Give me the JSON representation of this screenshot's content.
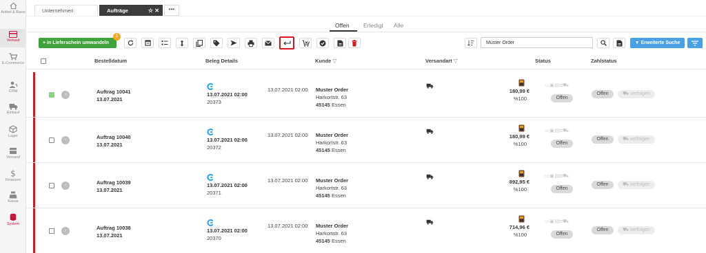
{
  "sidebar": {
    "items": [
      {
        "label": "Artikel & Basis",
        "icon": "home-icon"
      },
      {
        "label": "Verkauf",
        "icon": "credit-card-icon"
      },
      {
        "label": "E-Commerce",
        "icon": "cart-icon"
      },
      {
        "label": "CRM",
        "icon": "user-phone-icon"
      },
      {
        "label": "Einkauf",
        "icon": "truck-icon"
      },
      {
        "label": "Lager",
        "icon": "box-icon"
      },
      {
        "label": "Versand",
        "icon": "package-icon"
      },
      {
        "label": "Finanzen",
        "icon": "dollar-icon"
      },
      {
        "label": "Kasse",
        "icon": "register-icon"
      },
      {
        "label": "System",
        "icon": "database-icon"
      }
    ]
  },
  "doc_tabs": {
    "tab1": "Unternehmen",
    "tab2": "Aufträge",
    "more": "•••"
  },
  "status_tabs": {
    "open": "Offen",
    "done": "Erledigt",
    "all": "Alle"
  },
  "toolbar": {
    "convert_label": "in Lieferschein umwandeln",
    "badge": "1",
    "search_value": "Muster Order",
    "extended_search": "Erweiterte Suche"
  },
  "table": {
    "headers": {
      "order_date": "Bestelldatum",
      "doc_details": "Beleg Details",
      "customer": "Kunde",
      "shipping": "Versandart",
      "status": "Status",
      "payment": "Zahlstatus"
    },
    "rows": [
      {
        "order": "Auftrag 10041",
        "date": "13.07.2021",
        "doc_date": "13.07.2021 02:00",
        "doc_no": "20373",
        "created": "13.07.2021 02:00",
        "name": "Muster Order",
        "street": "Harkortstr. 63",
        "zip": "45145",
        "city": "Essen",
        "amount": "180,99 €",
        "percent": "%100",
        "status": "Offen",
        "pay": "Offen",
        "track": "verfolgen",
        "checked": true
      },
      {
        "order": "Auftrag 10040",
        "date": "13.07.2021",
        "doc_date": "13.07.2021 02:00",
        "doc_no": "20372",
        "created": "13.07.2021 02:00",
        "name": "Muster Order",
        "street": "Harkortstr. 63",
        "zip": "45145",
        "city": "Essen",
        "amount": "180,99 €",
        "percent": "%100",
        "status": "Offen",
        "pay": "Offen",
        "track": "verfolgen",
        "checked": false
      },
      {
        "order": "Auftrag 10039",
        "date": "13.07.2021",
        "doc_date": "13.07.2021 02:00",
        "doc_no": "20371",
        "created": "13.07.2021 02:00",
        "name": "Muster Order",
        "street": "Harkortstr. 63",
        "zip": "45145",
        "city": "Essen",
        "amount": "892,95 €",
        "percent": "%100",
        "status": "Offen",
        "pay": "Offen",
        "track": "verfolgen",
        "checked": false
      },
      {
        "order": "Auftrag 10038",
        "date": "13.07.2021",
        "doc_date": "13.07.2021 02:00",
        "doc_no": "20370",
        "created": "13.07.2021 02:00",
        "name": "Muster Order",
        "street": "Harkortstr. 63",
        "zip": "45145",
        "city": "Essen",
        "amount": "714,96 €",
        "percent": "%100",
        "status": "Offen",
        "pay": "Offen",
        "track": "verfolgen",
        "checked": false
      }
    ]
  },
  "colors": {
    "accent_green": "#3ea33a",
    "accent_blue": "#4aa0e6",
    "row_marker_red": "#e0111d",
    "highlight_red": "#e0111d"
  }
}
